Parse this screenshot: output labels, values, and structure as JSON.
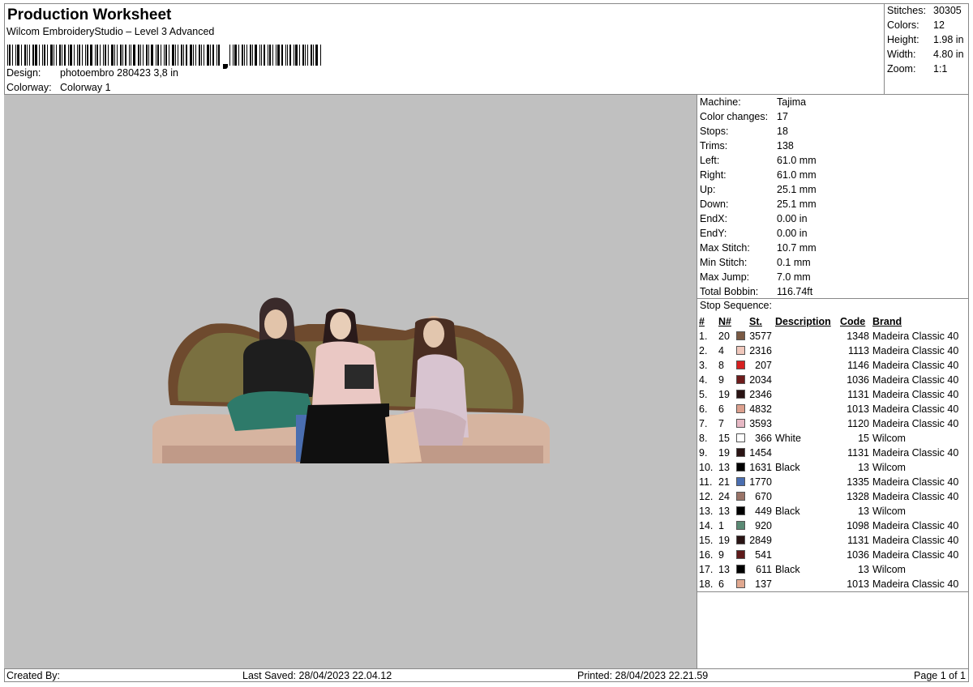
{
  "header": {
    "title": "Production Worksheet",
    "software": "Wilcom EmbroideryStudio – Level 3 Advanced",
    "design_label": "Design:",
    "design_value": "photoembro 280423 3,8 in",
    "colorway_label": "Colorway:",
    "colorway_value": "Colorway 1"
  },
  "summary": [
    {
      "label": "Stitches:",
      "value": "30305"
    },
    {
      "label": "Colors:",
      "value": "12"
    },
    {
      "label": "Height:",
      "value": "1.98 in"
    },
    {
      "label": "Width:",
      "value": "4.80 in"
    },
    {
      "label": "Zoom:",
      "value": "1:1"
    }
  ],
  "machine": [
    {
      "label": "Machine:",
      "value": "Tajima"
    },
    {
      "label": "Color changes:",
      "value": "17"
    },
    {
      "label": "Stops:",
      "value": "18"
    },
    {
      "label": "Trims:",
      "value": "138"
    },
    {
      "label": "Left:",
      "value": "61.0 mm"
    },
    {
      "label": "Right:",
      "value": "61.0 mm"
    },
    {
      "label": "Up:",
      "value": "25.1 mm"
    },
    {
      "label": "Down:",
      "value": "25.1 mm"
    },
    {
      "label": "EndX:",
      "value": "0.00 in"
    },
    {
      "label": "EndY:",
      "value": "0.00 in"
    },
    {
      "label": "Max Stitch:",
      "value": "10.7 mm"
    },
    {
      "label": "Min Stitch:",
      "value": "0.1 mm"
    },
    {
      "label": "Max Jump:",
      "value": "7.0 mm"
    },
    {
      "label": "Total Bobbin:",
      "value": "116.74ft"
    }
  ],
  "stop_sequence": {
    "heading": "Stop Sequence:",
    "columns": [
      "#",
      "N#",
      "St.",
      "Description",
      "Code",
      "Brand"
    ],
    "rows": [
      {
        "idx": "1.",
        "n": "20",
        "color": "#7a5a44",
        "st": "3577",
        "desc": "",
        "code": "1348",
        "brand": "Madeira Classic 40"
      },
      {
        "idx": "2.",
        "n": "4",
        "color": "#f0c8bc",
        "st": "2316",
        "desc": "",
        "code": "1113",
        "brand": "Madeira Classic 40"
      },
      {
        "idx": "3.",
        "n": "8",
        "color": "#d62020",
        "st": "207",
        "desc": "",
        "code": "1146",
        "brand": "Madeira Classic 40"
      },
      {
        "idx": "4.",
        "n": "9",
        "color": "#6e1c1c",
        "st": "2034",
        "desc": "",
        "code": "1036",
        "brand": "Madeira Classic 40"
      },
      {
        "idx": "5.",
        "n": "19",
        "color": "#2a1414",
        "st": "2346",
        "desc": "",
        "code": "1131",
        "brand": "Madeira Classic 40"
      },
      {
        "idx": "6.",
        "n": "6",
        "color": "#dca08e",
        "st": "4832",
        "desc": "",
        "code": "1013",
        "brand": "Madeira Classic 40"
      },
      {
        "idx": "7.",
        "n": "7",
        "color": "#e6b8c4",
        "st": "3593",
        "desc": "",
        "code": "1120",
        "brand": "Madeira Classic 40"
      },
      {
        "idx": "8.",
        "n": "15",
        "color": "#ffffff",
        "st": "366",
        "desc": "White",
        "code": "15",
        "brand": "Wilcom"
      },
      {
        "idx": "9.",
        "n": "19",
        "color": "#2a1414",
        "st": "1454",
        "desc": "",
        "code": "1131",
        "brand": "Madeira Classic 40"
      },
      {
        "idx": "10.",
        "n": "13",
        "color": "#000000",
        "st": "1631",
        "desc": "Black",
        "code": "13",
        "brand": "Wilcom"
      },
      {
        "idx": "11.",
        "n": "21",
        "color": "#4a6eb0",
        "st": "1770",
        "desc": "",
        "code": "1335",
        "brand": "Madeira Classic 40"
      },
      {
        "idx": "12.",
        "n": "24",
        "color": "#9a7468",
        "st": "670",
        "desc": "",
        "code": "1328",
        "brand": "Madeira Classic 40"
      },
      {
        "idx": "13.",
        "n": "13",
        "color": "#000000",
        "st": "449",
        "desc": "Black",
        "code": "13",
        "brand": "Wilcom"
      },
      {
        "idx": "14.",
        "n": "1",
        "color": "#5a8a74",
        "st": "920",
        "desc": "",
        "code": "1098",
        "brand": "Madeira Classic 40"
      },
      {
        "idx": "15.",
        "n": "19",
        "color": "#2a1414",
        "st": "2849",
        "desc": "",
        "code": "1131",
        "brand": "Madeira Classic 40"
      },
      {
        "idx": "16.",
        "n": "9",
        "color": "#5e1a1a",
        "st": "541",
        "desc": "",
        "code": "1036",
        "brand": "Madeira Classic 40"
      },
      {
        "idx": "17.",
        "n": "13",
        "color": "#000000",
        "st": "611",
        "desc": "Black",
        "code": "13",
        "brand": "Wilcom"
      },
      {
        "idx": "18.",
        "n": "6",
        "color": "#e0a890",
        "st": "137",
        "desc": "",
        "code": "1013",
        "brand": "Madeira Classic 40"
      }
    ]
  },
  "footer": {
    "created_by": "Created By:",
    "last_saved": "Last Saved: 28/04/2023 22.04.12",
    "printed": "Printed: 28/04/2023 22.21.59",
    "page": "Page 1 of 1"
  }
}
